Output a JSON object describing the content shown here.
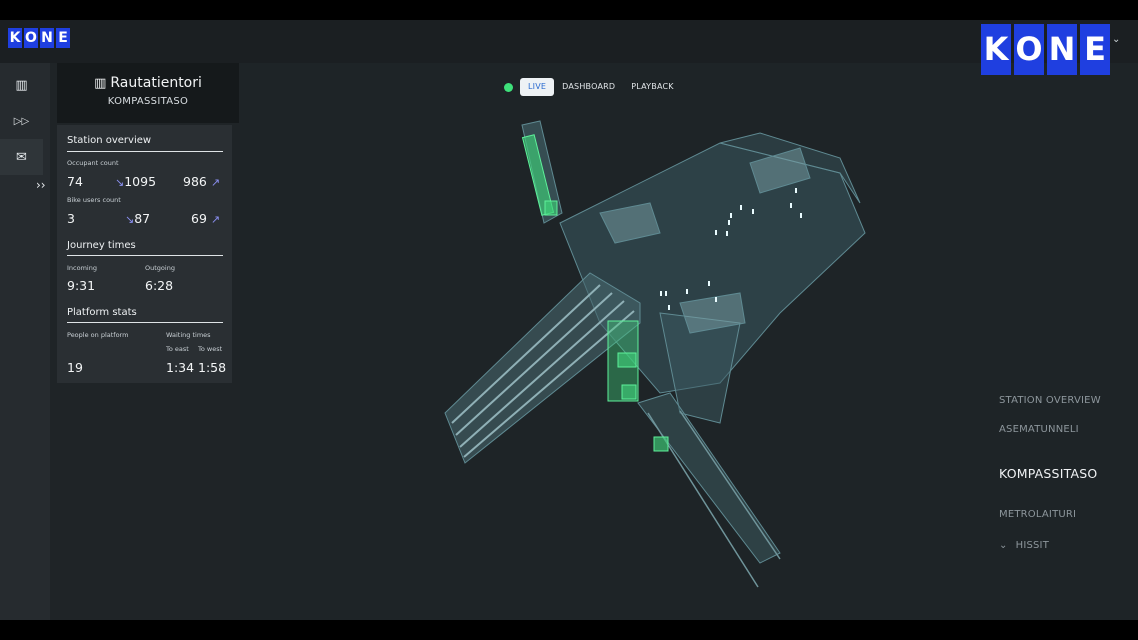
{
  "brand": {
    "logo_small": [
      "K",
      "O",
      "N",
      "E"
    ],
    "logo_large": [
      "K",
      "O",
      "N",
      "E"
    ],
    "color": "#1f3fe0"
  },
  "sidebar": {
    "items": [
      {
        "icon": "building-icon",
        "glyph": "▥"
      },
      {
        "icon": "fast-forward-icon",
        "glyph": "▷▷"
      },
      {
        "icon": "mail-icon",
        "glyph": "✉"
      }
    ],
    "expand_glyph": "››"
  },
  "station": {
    "name": "Rautatientori",
    "level": "KOMPASSITASO"
  },
  "overview": {
    "title": "Station overview",
    "occupant": {
      "label": "Occupant count",
      "current": "74",
      "in": "1095",
      "out": "986"
    },
    "bike": {
      "label": "Bike users count",
      "current": "3",
      "in": "87",
      "out": "69"
    }
  },
  "journey": {
    "title": "Journey times",
    "incoming_label": "Incoming",
    "incoming": "9:31",
    "outgoing_label": "Outgoing",
    "outgoing": "6:28"
  },
  "platform": {
    "title": "Platform stats",
    "people_label": "People on platform",
    "people": "19",
    "waiting_label": "Waiting times",
    "east_label": "To east",
    "east": "1:34",
    "west_label": "To west",
    "west": "1:58"
  },
  "modes": {
    "live": "LIVE",
    "dashboard": "DASHBOARD",
    "playback": "PLAYBACK",
    "live_color": "#3ee07a"
  },
  "levels": {
    "station_overview": "STATION OVERVIEW",
    "asematunneli": "ASEMATUNNELI",
    "kompassitaso": "KOMPASSITASO",
    "metrolaituri": "METROLAITURI",
    "hissit": "HISSIT"
  }
}
